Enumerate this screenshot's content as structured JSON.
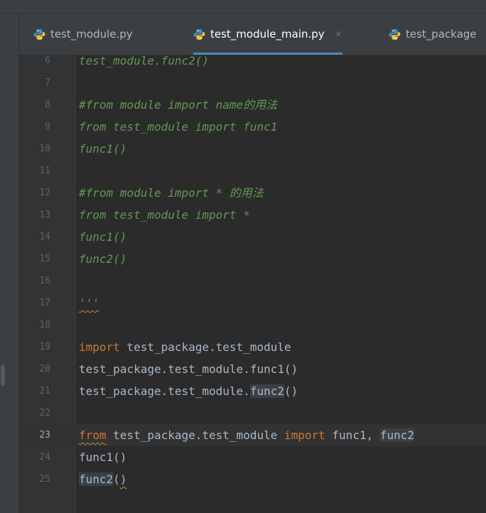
{
  "tabs": [
    {
      "label": "test_module.py",
      "active": false,
      "closable": false
    },
    {
      "label": "test_module_main.py",
      "active": true,
      "closable": true,
      "close_glyph": "×"
    },
    {
      "label": "test_package",
      "active": false,
      "closable": false
    }
  ],
  "editor": {
    "current_line": 23,
    "lines": [
      {
        "num": "6",
        "segments": [
          {
            "text": "test_module.func2()",
            "style": "str"
          }
        ]
      },
      {
        "num": "7",
        "segments": []
      },
      {
        "num": "8",
        "segments": [
          {
            "text": "#from module import name的用法",
            "style": "str"
          }
        ]
      },
      {
        "num": "9",
        "segments": [
          {
            "text": "from test_module import func1",
            "style": "str"
          }
        ]
      },
      {
        "num": "10",
        "segments": [
          {
            "text": "func1()",
            "style": "str"
          }
        ]
      },
      {
        "num": "11",
        "segments": []
      },
      {
        "num": "12",
        "segments": [
          {
            "text": "#from module import * 的用法",
            "style": "str"
          }
        ]
      },
      {
        "num": "13",
        "segments": [
          {
            "text": "from test_module import *",
            "style": "str"
          }
        ]
      },
      {
        "num": "14",
        "segments": [
          {
            "text": "func1()",
            "style": "str"
          }
        ]
      },
      {
        "num": "15",
        "segments": [
          {
            "text": "func2()",
            "style": "str"
          }
        ]
      },
      {
        "num": "16",
        "segments": []
      },
      {
        "num": "17",
        "segments": [
          {
            "text": "'''",
            "style": "str-squig"
          }
        ]
      },
      {
        "num": "18",
        "segments": []
      },
      {
        "num": "19",
        "segments": [
          {
            "text": "import",
            "style": "kw"
          },
          {
            "text": " test_package.test_module",
            "style": "plain"
          }
        ]
      },
      {
        "num": "20",
        "segments": [
          {
            "text": "test_package.test_module.func1()",
            "style": "plain"
          }
        ]
      },
      {
        "num": "21",
        "segments": [
          {
            "text": "test_package.test_module.",
            "style": "plain"
          },
          {
            "text": "func2",
            "style": "hl"
          },
          {
            "text": "()",
            "style": "plain"
          }
        ]
      },
      {
        "num": "22",
        "segments": []
      },
      {
        "num": "23",
        "segments": [
          {
            "text": "from",
            "style": "kw-squig"
          },
          {
            "text": " test_package.test_module ",
            "style": "plain"
          },
          {
            "text": "import",
            "style": "kw"
          },
          {
            "text": " func1, ",
            "style": "plain"
          },
          {
            "text": "func2",
            "style": "hl"
          }
        ]
      },
      {
        "num": "24",
        "segments": [
          {
            "text": "func1()",
            "style": "plain"
          }
        ]
      },
      {
        "num": "25",
        "segments": [
          {
            "text": "func2",
            "style": "hl"
          },
          {
            "text": "(",
            "style": "plain"
          },
          {
            "text": ")",
            "style": "plain-squig"
          }
        ]
      }
    ]
  },
  "colors": {
    "background": "#2b2b2b",
    "keyword": "#cc7832",
    "docstring": "#629755",
    "identifier": "#a9b7c6",
    "line_number": "#606366",
    "tab_accent": "#4a88c7"
  },
  "icons": {
    "file_type": "python-icon",
    "close": "close-icon"
  }
}
